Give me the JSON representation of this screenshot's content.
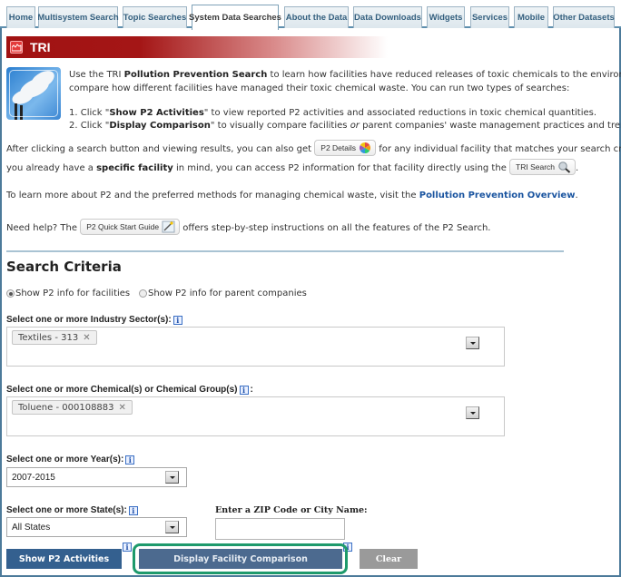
{
  "tabs": [
    {
      "label": "Home",
      "active": false
    },
    {
      "label": "Multisystem Search",
      "active": false
    },
    {
      "label": "Topic Searches",
      "active": false
    },
    {
      "label": "System Data Searches",
      "active": true
    },
    {
      "label": "About the Data",
      "active": false
    },
    {
      "label": "Data Downloads",
      "active": false
    },
    {
      "label": "Widgets",
      "active": false
    },
    {
      "label": "Services",
      "active": false
    },
    {
      "label": "Mobile",
      "active": false
    },
    {
      "label": "Other Datasets",
      "active": false
    }
  ],
  "banner": {
    "title": "TRI",
    "icon": "factory-chart-icon"
  },
  "intro": {
    "line1_a": "Use the TRI ",
    "line1_b": "Pollution Prevention Search",
    "line1_c": " to learn how facilities have reduced releases of toxic chemicals to the environment and",
    "line2": "compare how different facilities have managed their toxic chemical waste. You can run two types of searches:",
    "step1_a": "1. Click \"",
    "step1_b": "Show P2 Activities",
    "step1_c": "\" to view reported P2 activities and associated reductions in toxic chemical quantities.",
    "step2_a": "2. Click \"",
    "step2_b": "Display Comparison",
    "step2_c": "\" to visually compare facilities ",
    "step2_d": "or",
    "step2_e": " parent companies' waste management practices and trends.",
    "after_a": "After clicking a search button and viewing results, you can also get",
    "p2_details_button": "P2 Details",
    "after_b": "for any individual facility that matches your search criteria. If",
    "specific_a": "you already have a ",
    "specific_b": "specific facility",
    "specific_c": " in mind, you can access P2 information for that facility directly using the",
    "tri_search_button": "TRI Search",
    "period": ".",
    "learn_a": "To learn more about P2 and the preferred methods for managing chemical waste, visit the ",
    "learn_link": "Pollution Prevention Overview",
    "help_a": "Need help? The",
    "quick_start_button": "P2 Quick Start Guide",
    "help_b": "offers step-by-step instructions on all the features of the P2 Search."
  },
  "criteria": {
    "title": "Search Criteria",
    "radio_facilities": "Show P2 info for facilities",
    "radio_parents": "Show P2 info for parent companies",
    "radio_selected": "facilities",
    "sector_label": "Select one or more Industry Sector(s):",
    "sector_selected": [
      "Textiles - 313"
    ],
    "chemical_label": "Select one or more Chemical(s) or Chemical Group(s)",
    "chemical_label_suffix": ":",
    "chemical_selected": [
      "Toluene - 000108883"
    ],
    "year_label": "Select one or more Year(s):",
    "year_value": "2007-2015",
    "state_label": "Select one or more State(s):",
    "state_value": "All States",
    "zip_label": "Enter a ZIP Code or City Name:",
    "zip_value": "",
    "zip_placeholder": ""
  },
  "buttons": {
    "show": "Show P2 Activities",
    "compare": "Display Facility Comparison",
    "clear": "Clear"
  },
  "colors": {
    "tab_border": "#5e8fae",
    "banner_red": "#a11212",
    "primary_button": "#34608f",
    "compare_button": "#4c6a8f",
    "clear_button": "#9a9a9a",
    "highlight": "#1e9a6c",
    "link": "#1b55a0"
  }
}
